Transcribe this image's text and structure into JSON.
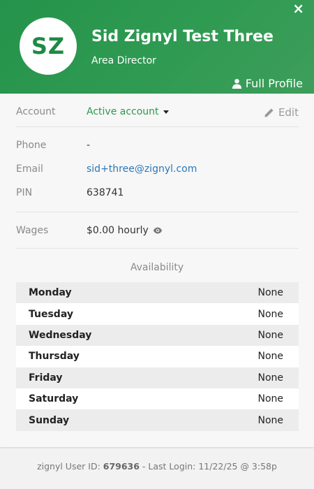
{
  "header": {
    "initials": "SZ",
    "name": "Sid Zignyl Test Three",
    "role": "Area Director",
    "full_profile_label": "Full Profile",
    "close_glyph": "×"
  },
  "account": {
    "label": "Account",
    "status": "Active account",
    "edit_label": "Edit"
  },
  "contact": {
    "phone_label": "Phone",
    "phone_value": "-",
    "email_label": "Email",
    "email_value": "sid+three@zignyl.com",
    "pin_label": "PIN",
    "pin_value": "638741"
  },
  "wages": {
    "label": "Wages",
    "value": "$0.00 hourly"
  },
  "availability": {
    "title": "Availability",
    "days": [
      {
        "day": "Monday",
        "value": "None"
      },
      {
        "day": "Tuesday",
        "value": "None"
      },
      {
        "day": "Wednesday",
        "value": "None"
      },
      {
        "day": "Thursday",
        "value": "None"
      },
      {
        "day": "Friday",
        "value": "None"
      },
      {
        "day": "Saturday",
        "value": "None"
      },
      {
        "day": "Sunday",
        "value": "None"
      }
    ]
  },
  "footer": {
    "user_id_prefix": "zignyl User ID: ",
    "user_id": "679636",
    "last_login_text": " - Last Login: 11/22/25 @ 3:58p"
  },
  "colors": {
    "brand_green": "#2a9a4d",
    "link_blue": "#2b78b8"
  }
}
